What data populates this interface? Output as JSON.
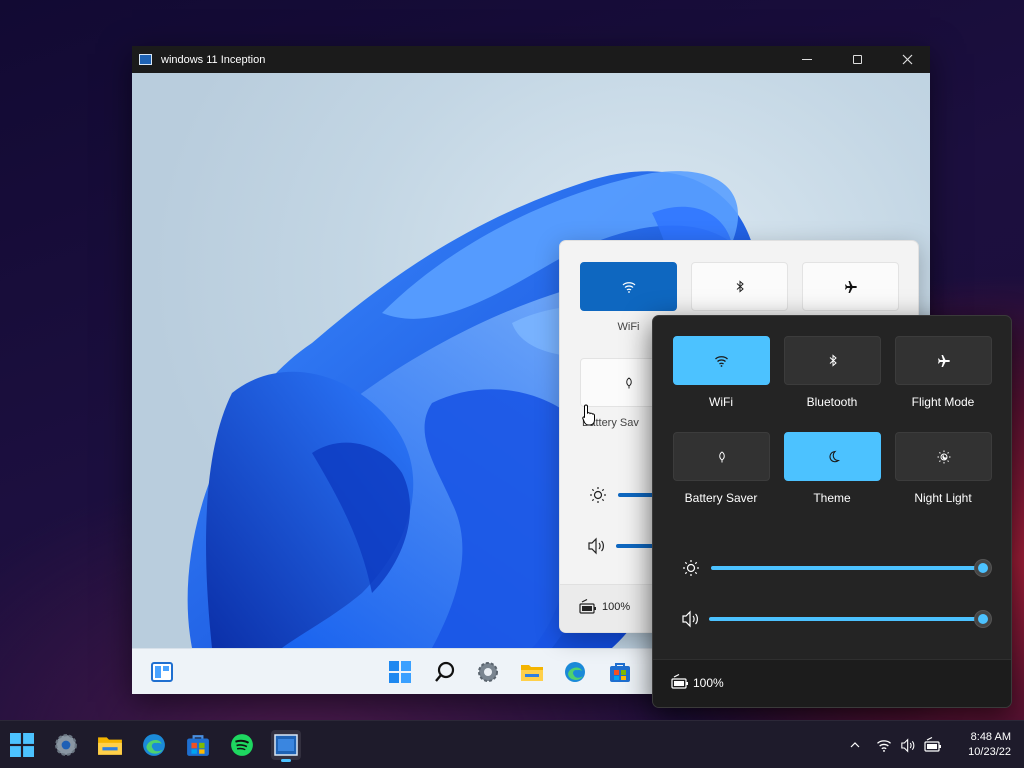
{
  "vm_window": {
    "title": "windows 11 Inception"
  },
  "light_quick_settings": {
    "tiles": [
      {
        "label": "WiFi",
        "icon": "wifi-icon",
        "active": true
      },
      {
        "label": "",
        "icon": "bluetooth-icon",
        "active": false
      },
      {
        "label": "",
        "icon": "airplane-icon",
        "active": false
      },
      {
        "label": "Battery Sav",
        "icon": "battery-saver-icon",
        "active": false
      }
    ],
    "battery": "100%"
  },
  "dark_quick_settings": {
    "tiles": [
      {
        "label": "WiFi",
        "icon": "wifi-icon",
        "active": true
      },
      {
        "label": "Bluetooth",
        "icon": "bluetooth-icon",
        "active": false
      },
      {
        "label": "Flight Mode",
        "icon": "airplane-icon",
        "active": false
      },
      {
        "label": "Battery Saver",
        "icon": "battery-saver-icon",
        "active": false
      },
      {
        "label": "Theme",
        "icon": "moon-icon",
        "active": true
      },
      {
        "label": "Night Light",
        "icon": "night-light-icon",
        "active": false
      }
    ],
    "brightness_level": 1.0,
    "volume_level": 1.0,
    "battery": "100%"
  },
  "vm_taskbar": {
    "items": [
      "widgets-icon",
      "start-icon",
      "search-icon",
      "settings-icon",
      "file-explorer-icon",
      "edge-icon",
      "store-icon"
    ]
  },
  "host_taskbar": {
    "items": [
      "start-icon",
      "settings-icon",
      "file-explorer-icon",
      "edge-icon",
      "store-icon",
      "spotify-icon",
      "vm-app-icon"
    ],
    "tray_icons": [
      "chevron-up-icon",
      "wifi-icon",
      "volume-icon",
      "battery-icon"
    ],
    "time": "8:48 AM",
    "date": "10/23/22"
  },
  "colors": {
    "accent_light": "#0e67c0",
    "accent_dark": "#4cc2ff",
    "dark_panel": "#242424"
  }
}
